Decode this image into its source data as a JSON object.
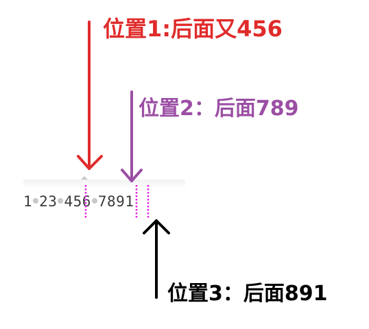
{
  "annotations": [
    {
      "id": "pos1",
      "text": "位置1:后面又456",
      "color": "#e02b2b"
    },
    {
      "id": "pos2",
      "text": "位置2：后面789",
      "color": "#9b4fa4"
    },
    {
      "id": "pos3",
      "text": "位置3：后面891",
      "color": "#000000"
    }
  ],
  "text_line": {
    "tokens": [
      "1",
      "23",
      "456",
      "7891"
    ]
  },
  "colors": {
    "cursor_marker": "#e21fe2",
    "space_dot": "#c8c8c8",
    "code_text": "#3a3a3a"
  },
  "icons": [
    "arrow-down-icon",
    "arrow-down-icon",
    "arrow-up-icon"
  ]
}
